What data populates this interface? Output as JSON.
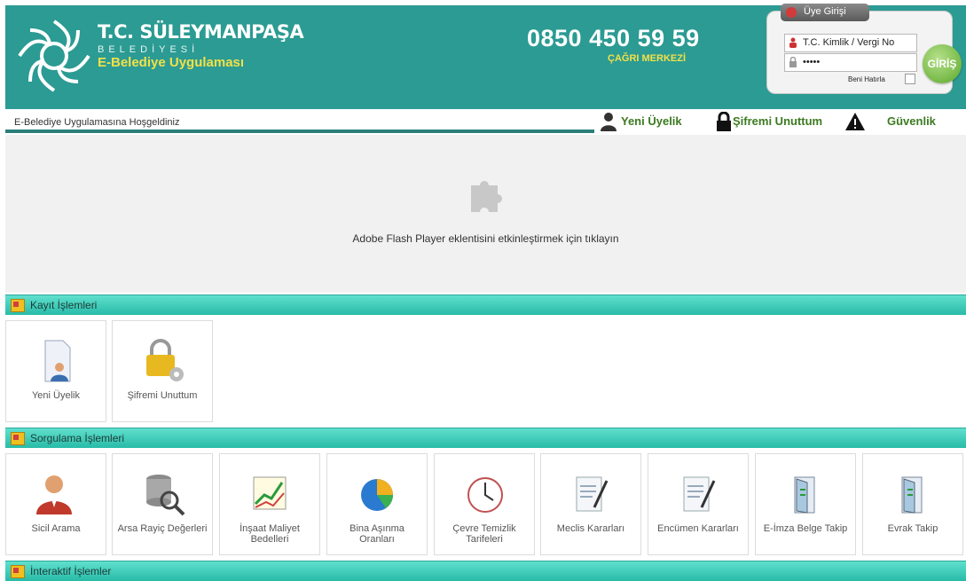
{
  "header": {
    "title": "T.C. SÜLEYMANPAŞA",
    "subtitle": "BELEDİYESİ",
    "app_name": "E-Belediye Uygulaması",
    "phone": "0850 450 59 59",
    "call_center": "ÇAĞRI MERKEZİ"
  },
  "login": {
    "tab_label": "Üye Girişi",
    "id_field": "T.C. Kimlik / Vergi No",
    "password_field": "•••••",
    "remember_label": "Beni Hatırla",
    "submit_label": "GİRİŞ"
  },
  "topbar": {
    "welcome": "E-Belediye Uygulamasına Hoşgeldiniz",
    "links": [
      "Yeni Üyelik",
      "Şifremi Unuttum",
      "Güvenlik"
    ]
  },
  "flash": {
    "message": "Adobe Flash Player eklentisini etkinleştirmek için tıklayın"
  },
  "sections": {
    "kayit": {
      "title": "Kayıt İşlemleri",
      "tiles": [
        "Yeni Üyelik",
        "Şifremi Unuttum"
      ]
    },
    "sorgulama": {
      "title": "Sorgulama İşlemleri",
      "tiles": [
        "Sicil Arama",
        "Arsa Rayiç Değerleri",
        "İnşaat Maliyet Bedelleri",
        "Bina Aşınma Oranları",
        "Çevre Temizlik Tarifeleri",
        "Meclis Kararları",
        "Encümen Kararları",
        "E-İmza Belge Takip",
        "Evrak Takip"
      ]
    },
    "interaktif": {
      "title": "İnteraktif İşlemler"
    }
  },
  "colors": {
    "header_bg": "#2b9b93",
    "section_bar": "#3cc9b5",
    "accent_yellow": "#f2e04a",
    "link_green": "#3c7a20"
  }
}
